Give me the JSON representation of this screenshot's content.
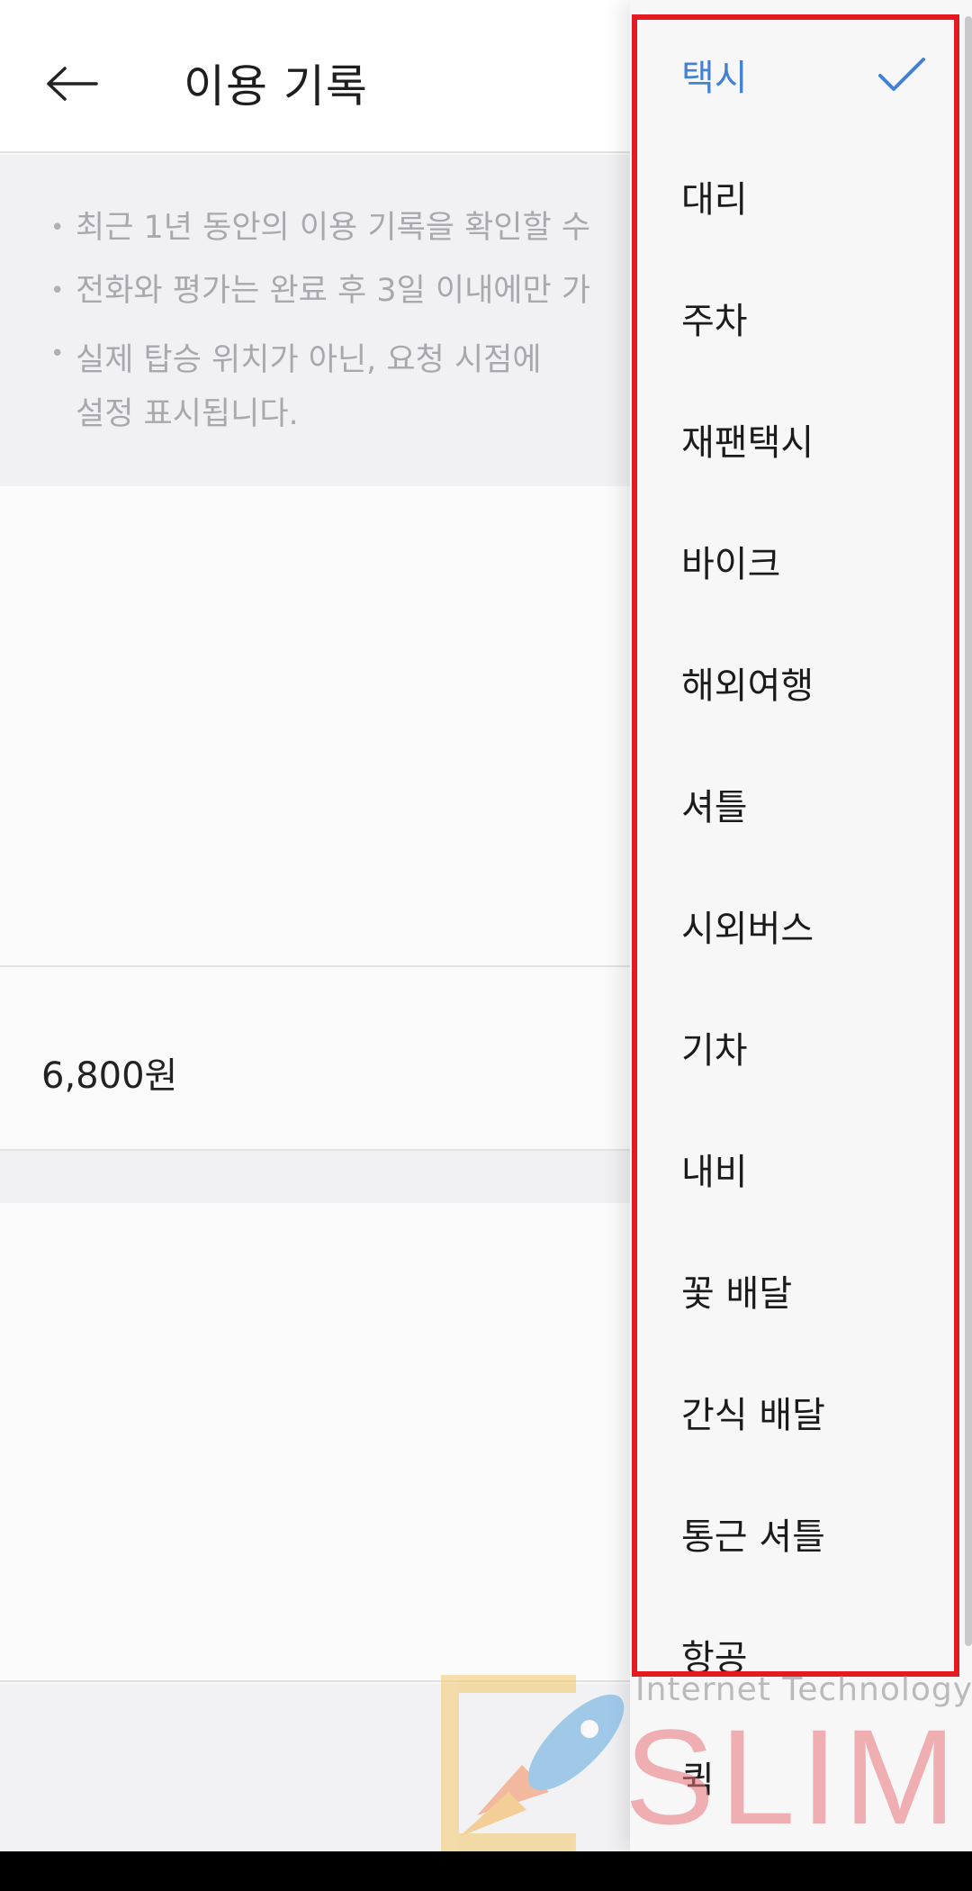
{
  "header": {
    "title": "이용 기록"
  },
  "notice": {
    "items": [
      "최근 1년 동안의 이용 기록을 확인할 수",
      "전화와 평가는 완료 후 3일 이내에만 가",
      "실제 탑승 위치가 아닌, 요청 시점에 설정 표시됩니다."
    ]
  },
  "ride": {
    "price": "6,800원"
  },
  "dropdown": {
    "selected_index": 0,
    "items": [
      "택시",
      "대리",
      "주차",
      "재팬택시",
      "바이크",
      "해외여행",
      "셔틀",
      "시외버스",
      "기차",
      "내비",
      "꽃 배달",
      "간식 배달",
      "통근 셔틀",
      "항공",
      "퀵"
    ]
  },
  "watermark": {
    "subtitle": "Internet Technology",
    "brand": "SLIM"
  },
  "colors": {
    "accent": "#4381d3",
    "highlight": "#e31a22",
    "watermark": "#e8747a"
  },
  "icons": {
    "back": "arrow-left-icon",
    "check": "check-icon"
  }
}
